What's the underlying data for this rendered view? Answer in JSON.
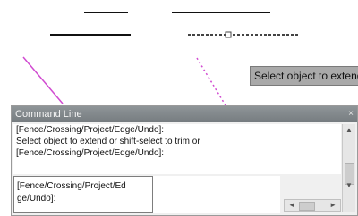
{
  "tooltip": {
    "text": "Select object to extend"
  },
  "command_line": {
    "title": "Command Line",
    "close_glyph": "×",
    "history": [
      "[Fence/Crossing/Project/Edge/Undo]:",
      "Select object to extend or shift-select to trim or",
      "[Fence/Crossing/Project/Edge/Undo]:"
    ],
    "input_lines": [
      "[Fence/Crossing/Project/Ed",
      "ge/Undo]:"
    ]
  },
  "icons": {
    "scroll_up": "▲",
    "scroll_down": "▼",
    "scroll_left": "◄",
    "scroll_right": "►"
  },
  "colors": {
    "line": "#111111",
    "selected_dash": "#555555",
    "magenta": "#d14bd1",
    "titlebar": "#7d8387",
    "tooltip_bg": "#a9a9a9"
  }
}
